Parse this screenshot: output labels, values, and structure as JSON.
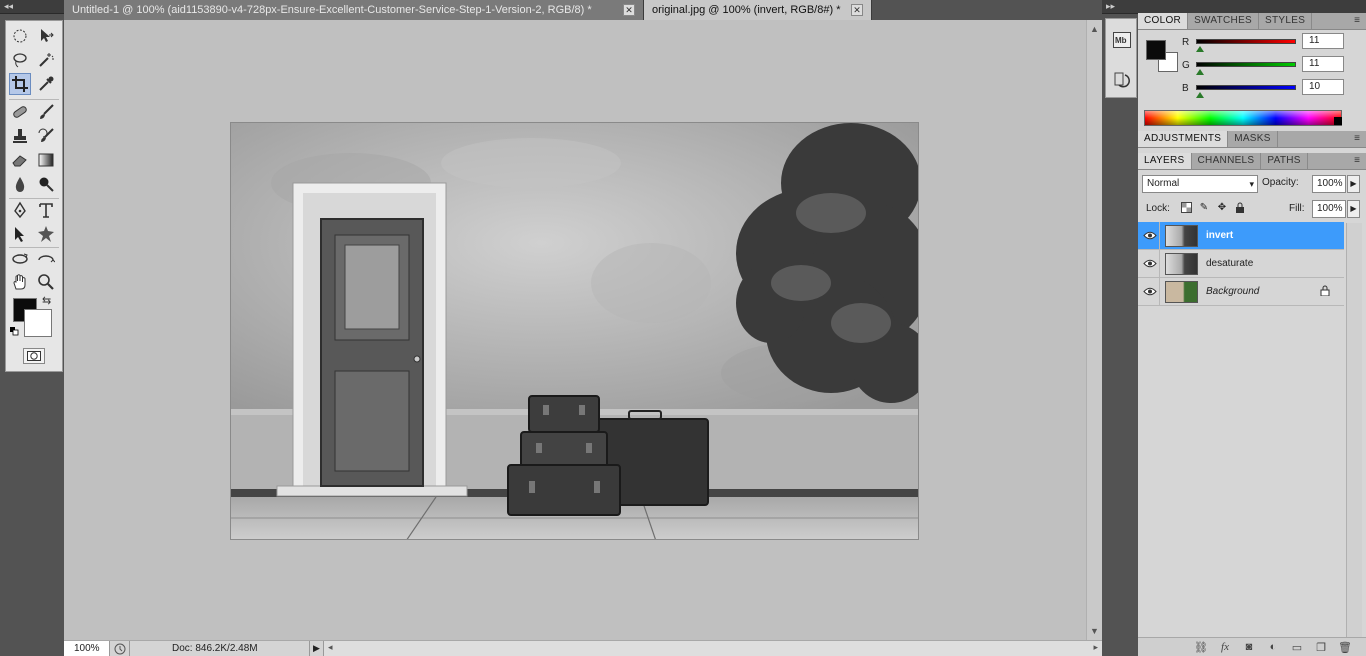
{
  "toolbox": {
    "tools": [
      "marquee-tool",
      "move-tool",
      "lasso-tool",
      "magic-wand-tool",
      "crop-tool",
      "eyedropper-tool",
      "healing-brush-tool",
      "brush-tool",
      "clone-stamp-tool",
      "history-brush-tool",
      "eraser-tool",
      "gradient-tool",
      "blur-tool",
      "dodge-tool",
      "pen-tool",
      "type-tool",
      "path-selection-tool",
      "shape-tool",
      "3d-rotate-tool",
      "3d-orbit-tool",
      "hand-tool",
      "zoom-tool"
    ],
    "foreground_color": "#0b0b0b",
    "background_color": "#ffffff"
  },
  "tabs": [
    {
      "label": "Untitled-1 @ 100% (aid1153890-v4-728px-Ensure-Excellent-Customer-Service-Step-1-Version-2, RGB/8) *",
      "active": false
    },
    {
      "label": "original.jpg @ 100% (invert, RGB/8#) *",
      "active": true
    }
  ],
  "status": {
    "zoom": "100%",
    "doc_info": "Doc: 846.2K/2.48M"
  },
  "color_panel": {
    "tabs": [
      "COLOR",
      "SWATCHES",
      "STYLES"
    ],
    "selected_tab": "COLOR",
    "channels": [
      {
        "label": "R",
        "value": "11",
        "gradient": "linear-gradient(to right,#000,#f00)",
        "level": 0.043
      },
      {
        "label": "G",
        "value": "11",
        "gradient": "linear-gradient(to right,#000,#0c0)",
        "level": 0.043
      },
      {
        "label": "B",
        "value": "10",
        "gradient": "linear-gradient(to right,#000,#00f)",
        "level": 0.039
      }
    ]
  },
  "adjustments_panel": {
    "tabs": [
      "ADJUSTMENTS",
      "MASKS"
    ],
    "selected_tab": "ADJUSTMENTS"
  },
  "layers_panel": {
    "tabs": [
      "LAYERS",
      "CHANNELS",
      "PATHS"
    ],
    "selected_tab": "LAYERS",
    "blend_mode": "Normal",
    "opacity_label": "Opacity:",
    "opacity": "100%",
    "lock_label": "Lock:",
    "fill_label": "Fill:",
    "fill": "100%",
    "layers": [
      {
        "name": "invert",
        "selected": true,
        "italic": false,
        "locked": false
      },
      {
        "name": "desaturate",
        "selected": false,
        "italic": false,
        "locked": false
      },
      {
        "name": "Background",
        "selected": false,
        "italic": true,
        "locked": true
      }
    ]
  },
  "mid_dock": {
    "buttons": [
      "mini-bridge-icon",
      "history-icon"
    ]
  }
}
